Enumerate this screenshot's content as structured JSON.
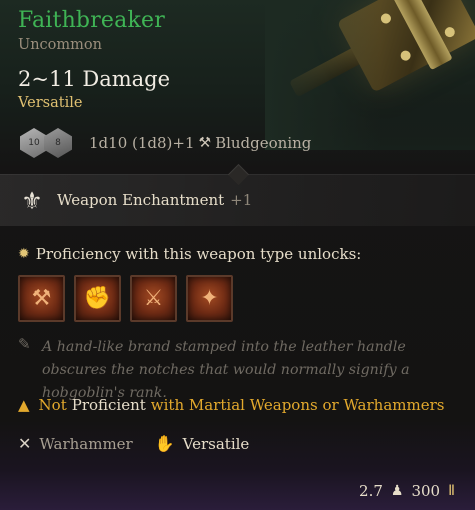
{
  "item": {
    "name": "Faithbreaker",
    "rarity": "Uncommon",
    "damage": "2~11 Damage",
    "property_top": "Versatile",
    "dice": {
      "die1": "10",
      "die2": "8"
    },
    "damage_formula": "1d10 (1d8)+1",
    "damage_type": "Bludgeoning"
  },
  "enchantment": {
    "label": "Weapon Enchantment",
    "bonus": "+1"
  },
  "proficiency": {
    "heading": "Proficiency with this weapon type unlocks:",
    "skills": [
      "⚒",
      "✊",
      "⚔",
      "✦"
    ]
  },
  "description": "A hand-like brand stamped into the leather handle obscures the notches that would normally signify a hobgoblin's rank.",
  "warning": {
    "not": "Not",
    "proficient": "Proficient",
    "rest": "with Martial Weapons or Warhammers"
  },
  "tags": [
    {
      "label": "Warhammer",
      "icon": "crossed-weapons-icon"
    },
    {
      "label": "Versatile",
      "icon": "hand-icon"
    }
  ],
  "footer": {
    "weight": "2.7",
    "value": "300"
  },
  "colors": {
    "title": "#3fb455",
    "accent": "#e0c172",
    "warning": "#e3a92d"
  }
}
